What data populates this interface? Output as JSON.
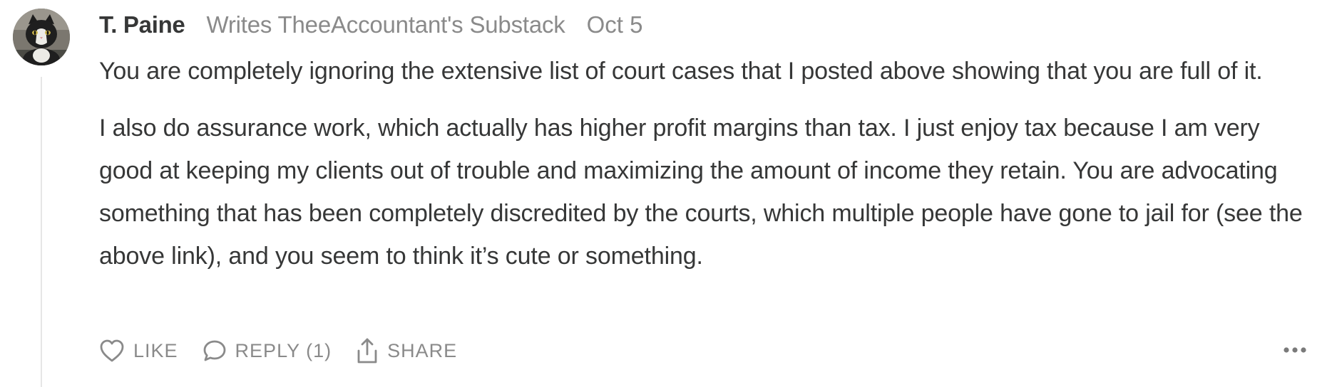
{
  "comment": {
    "author": "T. Paine",
    "byline": "Writes TheeAccountant's Substack",
    "date": "Oct 5",
    "paragraphs": [
      "You are completely ignoring the extensive list of court cases that I posted above showing that you are full of it.",
      "I also do assurance work, which actually has higher profit margins than tax. I just enjoy tax because I am very good at keeping my clients out of trouble and maximizing the amount of income they retain. You are advocating something that has been completely discredited by the courts, which multiple people have gone to jail for (see the above link), and you seem to think it’s cute or something."
    ],
    "actions": {
      "like_label": "LIKE",
      "reply_label": "REPLY (1)",
      "share_label": "SHARE"
    },
    "icons": {
      "like": "heart-icon",
      "reply": "speech-bubble-icon",
      "share": "share-icon",
      "more": "ellipsis-icon"
    },
    "colors": {
      "text": "#363737",
      "muted": "#8a8a8a",
      "thread_line": "#e6e6e6"
    }
  }
}
